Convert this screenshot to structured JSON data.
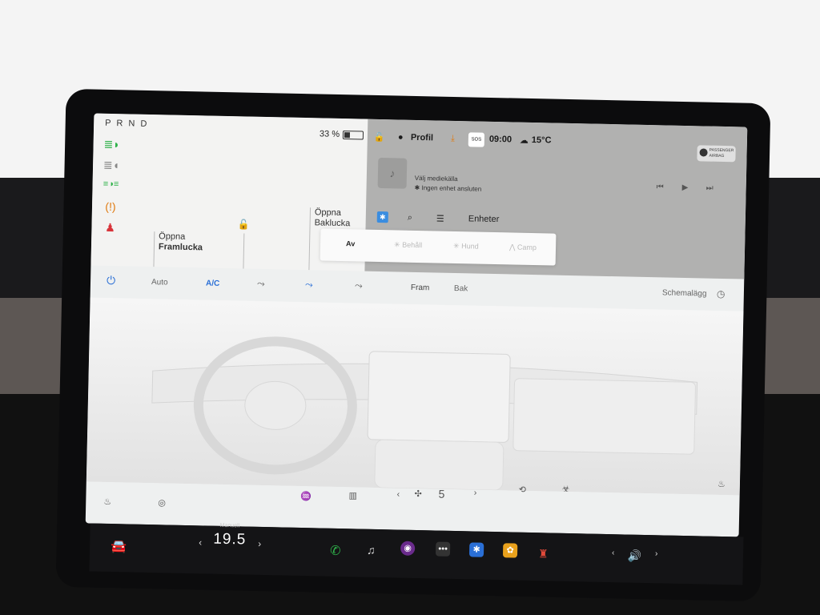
{
  "colors": {
    "accent": "#2a6fd6",
    "indicator_green": "#2fb24a",
    "warning_orange": "#e07b12",
    "seatbelt_red": "#d8333a"
  },
  "car": {
    "gear": "P R N D",
    "battery_percent_label": "33 %",
    "battery_level_fraction": 0.33,
    "front_trunk": {
      "line1": "Öppna",
      "line2": "Framlucka"
    },
    "rear_trunk": {
      "line1": "Öppna",
      "line2": "Baklucka"
    },
    "indicators": [
      "headlights-icon",
      "parking-lights-icon",
      "fog-lights-icon",
      "tire-pressure-warning-icon",
      "seatbelt-warning-icon"
    ]
  },
  "status": {
    "profile_label": "Profil",
    "sos_label": "SOS",
    "time": "09:00",
    "temperature": "15°C",
    "airbag_line1": "PASSENGER",
    "airbag_line2": "AIRBAG"
  },
  "media": {
    "source_prompt": "Välj mediekälla",
    "device_status": "Ingen enhet ansluten"
  },
  "tools": {
    "devices_label": "Enheter"
  },
  "modes": {
    "items": [
      {
        "label": "Av",
        "icon": ""
      },
      {
        "label": "Behåll",
        "icon": "keep-icon"
      },
      {
        "label": "Hund",
        "icon": "dog-icon"
      },
      {
        "label": "Camp",
        "icon": "camp-icon"
      }
    ]
  },
  "climate": {
    "auto_label": "Auto",
    "ac_label": "A/C",
    "front_label": "Fram",
    "rear_label": "Bak",
    "schedule_label": "Schemalägg",
    "fan_speed": "5"
  },
  "dock": {
    "mode_label": "Manuell",
    "cabin_temp": "19.5"
  }
}
